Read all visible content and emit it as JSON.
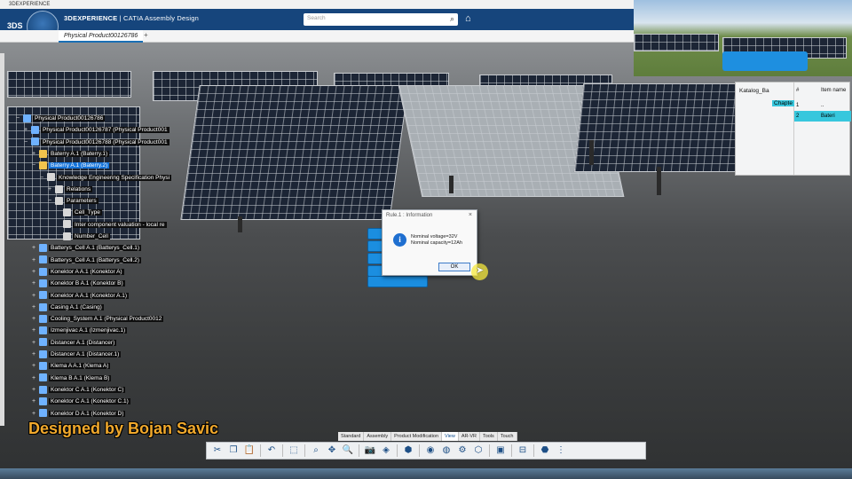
{
  "window": {
    "title": "3DEXPERIENCE"
  },
  "app": {
    "brand_bold": "3DEXPERIENCE",
    "brand_rest": " | CATIA Assembly Design",
    "compass_version": "V.R"
  },
  "search": {
    "placeholder": "Search"
  },
  "tab": {
    "label": "Physical Product00126786",
    "add_symbol": "+"
  },
  "tree": {
    "items": [
      {
        "label": "Physical Product00126786",
        "icon": "product-icon",
        "color": "#6fb2ff",
        "depth": 0,
        "expander": "−"
      },
      {
        "label": "Physical Product00126787 (Physical Product001",
        "icon": "product-icon",
        "color": "#6fb2ff",
        "depth": 1,
        "expander": "+"
      },
      {
        "label": "Physical Product00126788 (Physical Product001",
        "icon": "product-icon",
        "color": "#6fb2ff",
        "depth": 1,
        "expander": "−"
      },
      {
        "label": "Baterry A.1 (Baterry.1)",
        "icon": "part-icon",
        "color": "#f2c44d",
        "depth": 2,
        "expander": "+"
      },
      {
        "label": "Baterry A.1 (Baterry.2)",
        "icon": "part-icon",
        "color": "#f2c44d",
        "depth": 2,
        "expander": "−",
        "selected": true
      },
      {
        "label": "Knowledge Engineering Specification Physi",
        "icon": "knowledge-icon",
        "color": "#d8d8d8",
        "depth": 3,
        "expander": "−"
      },
      {
        "label": "Relations",
        "icon": "relations-icon",
        "color": "#d8d8d8",
        "depth": 4,
        "expander": "+"
      },
      {
        "label": "Parameters",
        "icon": "parameters-icon",
        "color": "#d8d8d8",
        "depth": 4,
        "expander": "−"
      },
      {
        "label": "Cell_Type",
        "icon": "parameter-icon",
        "color": "#d8d8d8",
        "depth": 5,
        "expander": ""
      },
      {
        "label": "Inter component valuation - local re",
        "icon": "parameter-icon",
        "color": "#d8d8d8",
        "depth": 5,
        "expander": ""
      },
      {
        "label": "Number_Cell",
        "icon": "parameter-icon",
        "color": "#d8d8d8",
        "depth": 5,
        "expander": ""
      },
      {
        "label": "Batterys_Cell A.1 (Batterys_Cell.1)",
        "icon": "product-icon",
        "color": "#6fb2ff",
        "depth": 2,
        "expander": "+"
      },
      {
        "label": "Batterys_Cell A.1 (Batterys_Cell.2)",
        "icon": "product-icon",
        "color": "#6fb2ff",
        "depth": 2,
        "expander": "+"
      },
      {
        "label": "Konektor A A.1 (Konektor A)",
        "icon": "product-icon",
        "color": "#6fb2ff",
        "depth": 2,
        "expander": "+"
      },
      {
        "label": "Konektor B A.1 (Konektor B)",
        "icon": "product-icon",
        "color": "#6fb2ff",
        "depth": 2,
        "expander": "+"
      },
      {
        "label": "Konektor A A.1 (Konektor A.1)",
        "icon": "product-icon",
        "color": "#6fb2ff",
        "depth": 2,
        "expander": "+"
      },
      {
        "label": "Casing A.1 (Casing)",
        "icon": "product-icon",
        "color": "#6fb2ff",
        "depth": 2,
        "expander": "+"
      },
      {
        "label": "Cooling_System A.1 (Physical Product0012",
        "icon": "product-icon",
        "color": "#6fb2ff",
        "depth": 2,
        "expander": "+"
      },
      {
        "label": "Izmenjivac A.1 (Izmenjivac.1)",
        "icon": "product-icon",
        "color": "#6fb2ff",
        "depth": 2,
        "expander": "+"
      },
      {
        "label": "Distancer A.1 (Distancer)",
        "icon": "product-icon",
        "color": "#6fb2ff",
        "depth": 2,
        "expander": "+"
      },
      {
        "label": "Distancer A.1 (Distancer.1)",
        "icon": "product-icon",
        "color": "#6fb2ff",
        "depth": 2,
        "expander": "+"
      },
      {
        "label": "Klema A A.1 (Klema A)",
        "icon": "product-icon",
        "color": "#6fb2ff",
        "depth": 2,
        "expander": "+"
      },
      {
        "label": "Klema B A.1 (Klema B)",
        "icon": "product-icon",
        "color": "#6fb2ff",
        "depth": 2,
        "expander": "+"
      },
      {
        "label": "Konektor C A.1 (Konektor C)",
        "icon": "product-icon",
        "color": "#6fb2ff",
        "depth": 2,
        "expander": "+"
      },
      {
        "label": "Konektor C A.1 (Konektor C.1)",
        "icon": "product-icon",
        "color": "#6fb2ff",
        "depth": 2,
        "expander": "+"
      },
      {
        "label": "Konektor D A.1 (Konektor D)",
        "icon": "product-icon",
        "color": "#6fb2ff",
        "depth": 2,
        "expander": "+"
      }
    ]
  },
  "catalog": {
    "root_label": "Katalog_Ba",
    "child_label": "Chapte",
    "col_hash": "#",
    "col_item": "Item name",
    "rows": [
      {
        "num": "1",
        "name": ".."
      },
      {
        "num": "2",
        "name": "Bateri",
        "highlight": true
      }
    ]
  },
  "dialog": {
    "title": "Rule.1 : Information",
    "close": "×",
    "icon": "info-icon",
    "line1": "Nominal voltage=32V",
    "line2": "Nominal capacity=12Ah",
    "ok_label": "OK"
  },
  "watermark": {
    "text": "Designed by Bojan Savic"
  },
  "workbench_tabs": [
    {
      "label": "Standard",
      "active": false
    },
    {
      "label": "Assembly",
      "active": false
    },
    {
      "label": "Product Modification",
      "active": false
    },
    {
      "label": "View",
      "active": true
    },
    {
      "label": "AR-VR",
      "active": false
    },
    {
      "label": "Tools",
      "active": false
    },
    {
      "label": "Touch",
      "active": false
    }
  ],
  "action_bar": {
    "tools": [
      {
        "name": "cut-icon",
        "glyph": "✂"
      },
      {
        "name": "copy-icon",
        "glyph": "❐"
      },
      {
        "name": "paste-icon",
        "glyph": "📋"
      },
      {
        "name": "sep"
      },
      {
        "name": "undo-icon",
        "glyph": "↶"
      },
      {
        "name": "sep"
      },
      {
        "name": "select-icon",
        "glyph": "⬚"
      },
      {
        "name": "sep"
      },
      {
        "name": "zoom-icon",
        "glyph": "⌕"
      },
      {
        "name": "pan-icon",
        "glyph": "✥"
      },
      {
        "name": "search-zoom-icon",
        "glyph": "🔍"
      },
      {
        "name": "sep"
      },
      {
        "name": "camera-icon",
        "glyph": "📷"
      },
      {
        "name": "view-icon",
        "glyph": "◈"
      },
      {
        "name": "sep"
      },
      {
        "name": "cube-view-icon",
        "glyph": "⬢"
      },
      {
        "name": "sep"
      },
      {
        "name": "render-icon",
        "glyph": "◉"
      },
      {
        "name": "hide-icon",
        "glyph": "◍"
      },
      {
        "name": "settings-icon",
        "glyph": "⚙"
      },
      {
        "name": "shade-icon",
        "glyph": "⬡"
      },
      {
        "name": "sep"
      },
      {
        "name": "window-icon",
        "glyph": "▣"
      },
      {
        "name": "sep"
      },
      {
        "name": "tree-icon",
        "glyph": "⊟"
      },
      {
        "name": "sep"
      },
      {
        "name": "part-cube-icon",
        "glyph": "⬣"
      },
      {
        "name": "more-icon",
        "glyph": "⋮"
      }
    ]
  }
}
